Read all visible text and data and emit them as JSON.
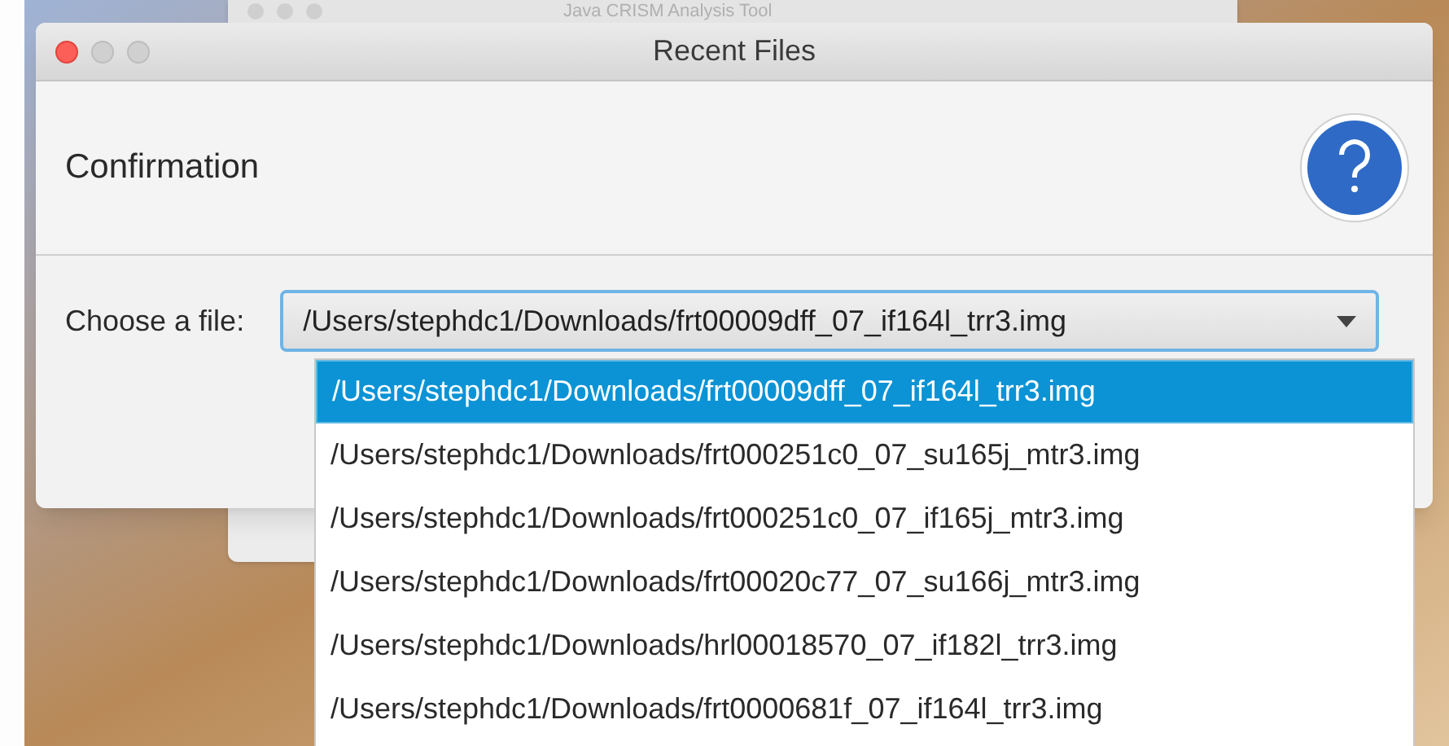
{
  "background_window": {
    "title": "Java CRISM Analysis Tool"
  },
  "window": {
    "title": "Recent Files"
  },
  "header": {
    "title": "Confirmation"
  },
  "form": {
    "label": "Choose a file:",
    "value": "/Users/stephdc1/Downloads/frt00009dff_07_if164l_trr3.img"
  },
  "dropdown": {
    "items": [
      {
        "label": "/Users/stephdc1/Downloads/frt00009dff_07_if164l_trr3.img",
        "selected": true
      },
      {
        "label": "/Users/stephdc1/Downloads/frt000251c0_07_su165j_mtr3.img",
        "selected": false
      },
      {
        "label": "/Users/stephdc1/Downloads/frt000251c0_07_if165j_mtr3.img",
        "selected": false
      },
      {
        "label": "/Users/stephdc1/Downloads/frt00020c77_07_su166j_mtr3.img",
        "selected": false
      },
      {
        "label": "/Users/stephdc1/Downloads/hrl00018570_07_if182l_trr3.img",
        "selected": false
      },
      {
        "label": "/Users/stephdc1/Downloads/frt0000681f_07_if164l_trr3.img",
        "selected": false
      }
    ]
  }
}
